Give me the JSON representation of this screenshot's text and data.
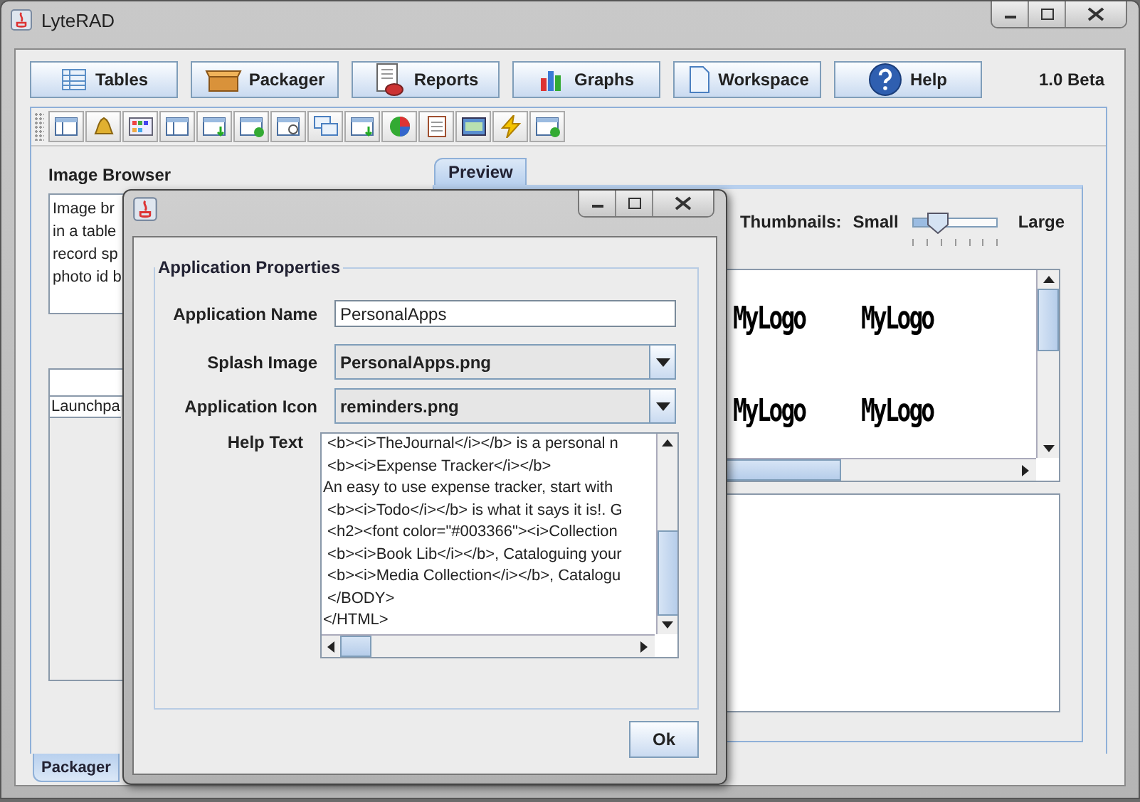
{
  "window": {
    "title": "LyteRAD"
  },
  "nav_buttons": [
    {
      "label": "Tables"
    },
    {
      "label": "Packager"
    },
    {
      "label": "Reports"
    },
    {
      "label": "Graphs"
    },
    {
      "label": "Workspace"
    },
    {
      "label": "Help"
    }
  ],
  "version": "1.0 Beta",
  "image_browser": {
    "title": "Image Browser",
    "description_lines": [
      "Image br",
      "in a table",
      "record sp",
      "photo id b"
    ],
    "list_items": [
      "Launchpa"
    ]
  },
  "preview": {
    "tab": {
      "label": "Preview",
      "selected": true
    },
    "thumbnails_label": "Thumbnails:",
    "small_label": "Small",
    "large_label": "Large",
    "size_slider": {
      "level": 0.3
    },
    "thumbnails": [
      "MyLogo",
      "MyLogo",
      "MyLogo",
      "MyLogo"
    ]
  },
  "bottom_tabs": [
    {
      "label": "Packager",
      "selected": true
    }
  ],
  "dialog": {
    "group_title": "Application Properties",
    "app_name": {
      "label": "Application Name",
      "value": "PersonalApps"
    },
    "splash_image": {
      "label": "Splash Image",
      "value": "PersonalApps.png"
    },
    "app_icon": {
      "label": "Application Icon",
      "value": "reminders.png"
    },
    "help_text": {
      "label": "Help Text",
      "lines": [
        " <b><i>TheJournal</i></b> is a personal n",
        " <b><i>Expense Tracker</i></b>",
        "An easy to use expense tracker, start with",
        " <b><i>Todo</i></b> is what it says it is!. G",
        " <h2><font color=\"#003366\"><i>Collection",
        " <b><i>Book Lib</i></b>, Cataloguing your",
        " <b><i>Media Collection</i></b>, Catalogu",
        " </BODY>",
        "</HTML>"
      ]
    },
    "ok_button": "Ok"
  }
}
